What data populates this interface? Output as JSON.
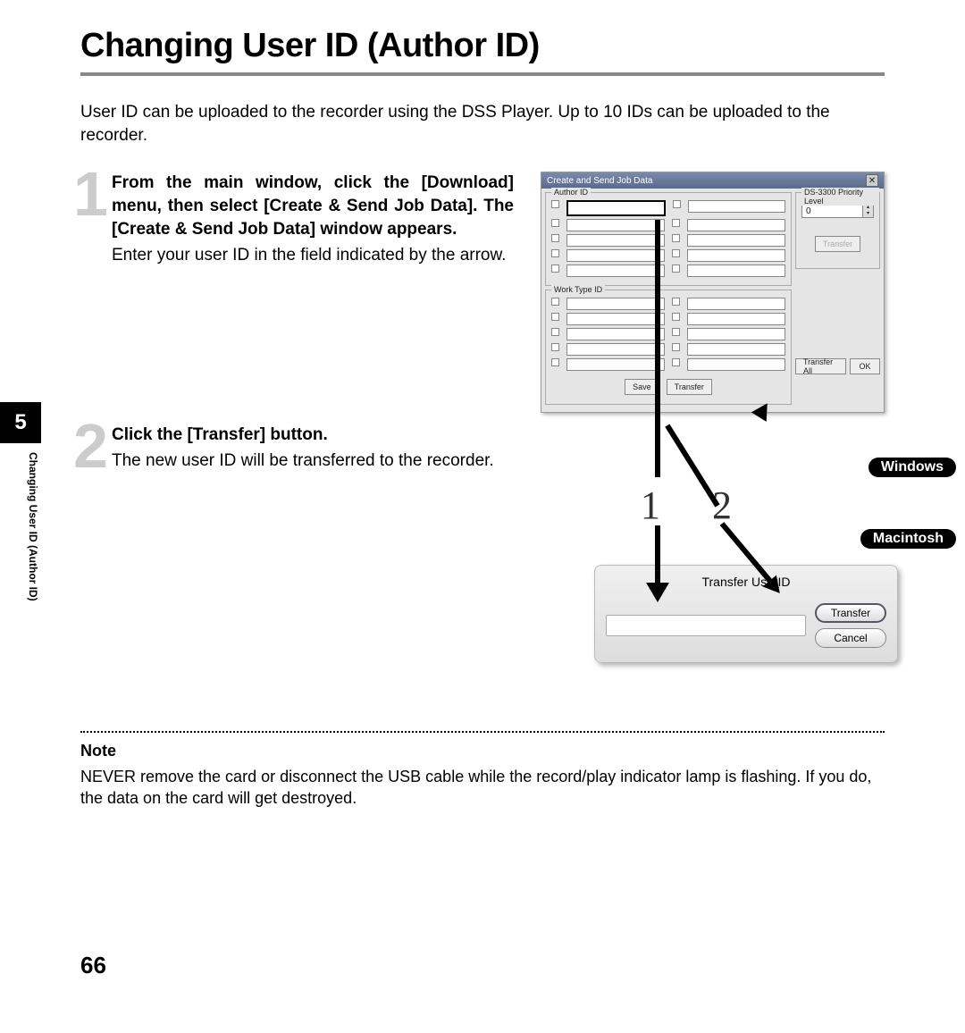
{
  "page": {
    "title": "Changing User ID (Author ID)",
    "intro": "User ID can be uploaded to the recorder using the DSS Player. Up to 10 IDs can be uploaded to the recorder.",
    "chapter_num": "5",
    "side_label": "Changing User ID (Author ID)",
    "page_number": "66"
  },
  "steps": [
    {
      "num": "1",
      "head": "From the main window, click the [Download] menu, then select [Create & Send Job Data]. The [Create & Send Job Data] window appears.",
      "body": "Enter your user ID in the field indicated by the arrow."
    },
    {
      "num": "2",
      "head": "Click the [Transfer] button.",
      "body": "The new user ID will be transferred to the recorder."
    }
  ],
  "windows_dialog": {
    "title": "Create and Send Job Data",
    "author_legend": "Author ID",
    "worktype_legend": "Work Type ID",
    "priority_legend": "DS-3300 Priority Level",
    "priority_value": "0",
    "btn_transfer": "Transfer",
    "btn_transfer_all": "Transfer All",
    "btn_ok": "OK",
    "btn_save": "Save"
  },
  "mac_dialog": {
    "title": "Transfer UserID",
    "btn_transfer": "Transfer",
    "btn_cancel": "Cancel"
  },
  "badges": {
    "windows": "Windows",
    "macintosh": "Macintosh"
  },
  "callouts": {
    "one": "1",
    "two": "2"
  },
  "note": {
    "head": "Note",
    "body": "NEVER remove the card or disconnect the USB cable while the record/play indicator lamp is flashing. If you do, the data on the card will get destroyed."
  }
}
